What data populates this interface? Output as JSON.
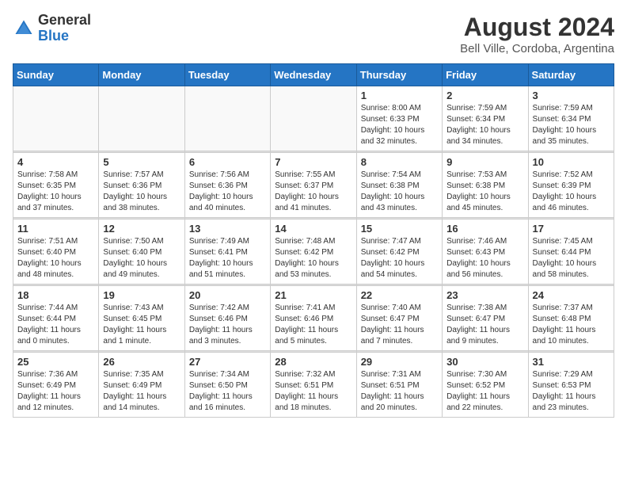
{
  "header": {
    "logo": {
      "general": "General",
      "blue": "Blue",
      "tagline": "Blue"
    },
    "title": "August 2024",
    "subtitle": "Bell Ville, Cordoba, Argentina"
  },
  "weekdays": [
    "Sunday",
    "Monday",
    "Tuesday",
    "Wednesday",
    "Thursday",
    "Friday",
    "Saturday"
  ],
  "weeks": [
    [
      {
        "day": "",
        "empty": true
      },
      {
        "day": "",
        "empty": true
      },
      {
        "day": "",
        "empty": true
      },
      {
        "day": "",
        "empty": true
      },
      {
        "day": "1",
        "sunrise": "8:00 AM",
        "sunset": "6:33 PM",
        "daylight": "10 hours and 32 minutes."
      },
      {
        "day": "2",
        "sunrise": "7:59 AM",
        "sunset": "6:34 PM",
        "daylight": "10 hours and 34 minutes."
      },
      {
        "day": "3",
        "sunrise": "7:59 AM",
        "sunset": "6:34 PM",
        "daylight": "10 hours and 35 minutes."
      }
    ],
    [
      {
        "day": "4",
        "sunrise": "7:58 AM",
        "sunset": "6:35 PM",
        "daylight": "10 hours and 37 minutes."
      },
      {
        "day": "5",
        "sunrise": "7:57 AM",
        "sunset": "6:36 PM",
        "daylight": "10 hours and 38 minutes."
      },
      {
        "day": "6",
        "sunrise": "7:56 AM",
        "sunset": "6:36 PM",
        "daylight": "10 hours and 40 minutes."
      },
      {
        "day": "7",
        "sunrise": "7:55 AM",
        "sunset": "6:37 PM",
        "daylight": "10 hours and 41 minutes."
      },
      {
        "day": "8",
        "sunrise": "7:54 AM",
        "sunset": "6:38 PM",
        "daylight": "10 hours and 43 minutes."
      },
      {
        "day": "9",
        "sunrise": "7:53 AM",
        "sunset": "6:38 PM",
        "daylight": "10 hours and 45 minutes."
      },
      {
        "day": "10",
        "sunrise": "7:52 AM",
        "sunset": "6:39 PM",
        "daylight": "10 hours and 46 minutes."
      }
    ],
    [
      {
        "day": "11",
        "sunrise": "7:51 AM",
        "sunset": "6:40 PM",
        "daylight": "10 hours and 48 minutes."
      },
      {
        "day": "12",
        "sunrise": "7:50 AM",
        "sunset": "6:40 PM",
        "daylight": "10 hours and 49 minutes."
      },
      {
        "day": "13",
        "sunrise": "7:49 AM",
        "sunset": "6:41 PM",
        "daylight": "10 hours and 51 minutes."
      },
      {
        "day": "14",
        "sunrise": "7:48 AM",
        "sunset": "6:42 PM",
        "daylight": "10 hours and 53 minutes."
      },
      {
        "day": "15",
        "sunrise": "7:47 AM",
        "sunset": "6:42 PM",
        "daylight": "10 hours and 54 minutes."
      },
      {
        "day": "16",
        "sunrise": "7:46 AM",
        "sunset": "6:43 PM",
        "daylight": "10 hours and 56 minutes."
      },
      {
        "day": "17",
        "sunrise": "7:45 AM",
        "sunset": "6:44 PM",
        "daylight": "10 hours and 58 minutes."
      }
    ],
    [
      {
        "day": "18",
        "sunrise": "7:44 AM",
        "sunset": "6:44 PM",
        "daylight": "11 hours and 0 minutes."
      },
      {
        "day": "19",
        "sunrise": "7:43 AM",
        "sunset": "6:45 PM",
        "daylight": "11 hours and 1 minute."
      },
      {
        "day": "20",
        "sunrise": "7:42 AM",
        "sunset": "6:46 PM",
        "daylight": "11 hours and 3 minutes."
      },
      {
        "day": "21",
        "sunrise": "7:41 AM",
        "sunset": "6:46 PM",
        "daylight": "11 hours and 5 minutes."
      },
      {
        "day": "22",
        "sunrise": "7:40 AM",
        "sunset": "6:47 PM",
        "daylight": "11 hours and 7 minutes."
      },
      {
        "day": "23",
        "sunrise": "7:38 AM",
        "sunset": "6:47 PM",
        "daylight": "11 hours and 9 minutes."
      },
      {
        "day": "24",
        "sunrise": "7:37 AM",
        "sunset": "6:48 PM",
        "daylight": "11 hours and 10 minutes."
      }
    ],
    [
      {
        "day": "25",
        "sunrise": "7:36 AM",
        "sunset": "6:49 PM",
        "daylight": "11 hours and 12 minutes."
      },
      {
        "day": "26",
        "sunrise": "7:35 AM",
        "sunset": "6:49 PM",
        "daylight": "11 hours and 14 minutes."
      },
      {
        "day": "27",
        "sunrise": "7:34 AM",
        "sunset": "6:50 PM",
        "daylight": "11 hours and 16 minutes."
      },
      {
        "day": "28",
        "sunrise": "7:32 AM",
        "sunset": "6:51 PM",
        "daylight": "11 hours and 18 minutes."
      },
      {
        "day": "29",
        "sunrise": "7:31 AM",
        "sunset": "6:51 PM",
        "daylight": "11 hours and 20 minutes."
      },
      {
        "day": "30",
        "sunrise": "7:30 AM",
        "sunset": "6:52 PM",
        "daylight": "11 hours and 22 minutes."
      },
      {
        "day": "31",
        "sunrise": "7:29 AM",
        "sunset": "6:53 PM",
        "daylight": "11 hours and 23 minutes."
      }
    ]
  ]
}
